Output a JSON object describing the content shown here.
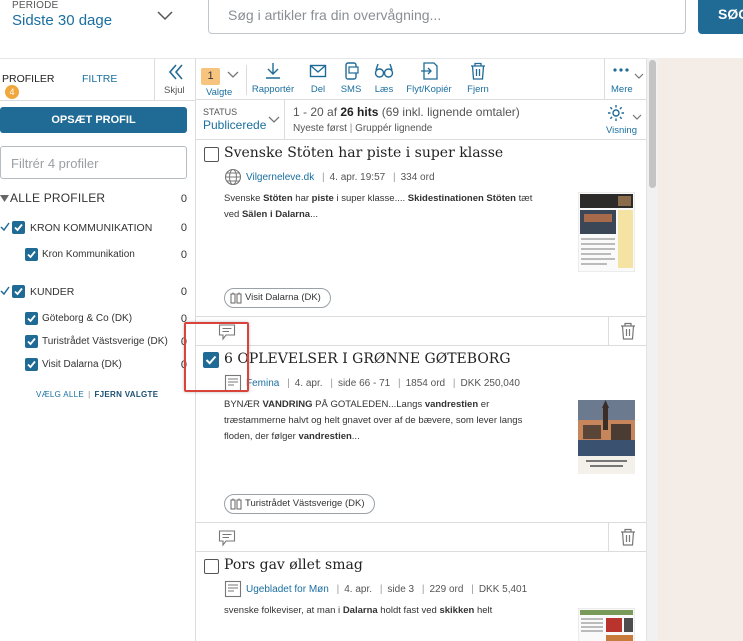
{
  "period": {
    "label": "PERIODE",
    "value": "Sidste 30 dage"
  },
  "search": {
    "placeholder": "Søg i artikler fra din overvågning...",
    "button": "SØG"
  },
  "left": {
    "tab_profiler": "PROFILER",
    "profiler_count": "4",
    "tab_filtre": "FILTRE",
    "skjul": "Skjul",
    "setup_button": "OPSÆT PROFIL",
    "filter_placeholder": "Filtrér 4 profiler",
    "all_profiles": {
      "label": "ALLE PROFILER",
      "count": "0"
    },
    "groups": [
      {
        "label": "KRON KOMMUNIKATION",
        "count": "0",
        "items": [
          {
            "label": "Kron Kommunikation",
            "count": "0"
          }
        ]
      },
      {
        "label": "KUNDER",
        "count": "0",
        "items": [
          {
            "label": "Göteborg & Co (DK)",
            "count": "0"
          },
          {
            "label": "Turistrådet Västsverige (DK)",
            "count": "0"
          },
          {
            "label": "Visit Dalarna (DK)",
            "count": "0"
          }
        ]
      }
    ],
    "select_all": "VÆLG ALLE",
    "remove_selected": "FJERN VALGTE"
  },
  "toolbar": {
    "selected_count": "1",
    "valgte": "Valgte",
    "rapporter": "Rapportér",
    "del": "Del",
    "sms": "SMS",
    "laes": "Læs",
    "flyt": "Flyt/Kopiér",
    "fjern": "Fjern",
    "mere": "Mere"
  },
  "status": {
    "label": "STATUS",
    "value": "Publicerede",
    "hits_prefix": "1 - 20 af ",
    "hits_bold": "26 hits",
    "hits_suffix": " (69 inkl. lignende omtaler)",
    "sort_newest": "Nyeste først",
    "sort_group": "Gruppér lignende",
    "visning": "Visning"
  },
  "articles": [
    {
      "title": "Svenske Stöten har piste i super klasse",
      "source": "Vilgerneleve.dk",
      "date": "4. apr. 19:57",
      "words": "334 ord",
      "snippet_parts": [
        "Svenske ",
        "Stöten",
        " har ",
        "piste",
        " i super klasse.... ",
        "Skidestinationen Stöten",
        " tæt ved ",
        "Sälen i Dalarna",
        "..."
      ],
      "tag": "Visit Dalarna (DK)",
      "checked": false
    },
    {
      "title": "6 OPLEVELSER I GRØNNE GØTEBORG",
      "source": "Femina",
      "date": "4. apr.",
      "pages": "side 66 - 71",
      "words": "1854 ord",
      "price": "DKK  250,040",
      "snippet_parts": [
        "BYNÆR ",
        "VANDRING",
        " PÅ GOTALEDEN...Langs ",
        "vandrestien",
        " er træstammerne halvt og helt gnavet over af de bævere, som lever langs floden, der følger ",
        "vandrestien",
        "..."
      ],
      "tag": "Turistrådet Västsverige (DK)",
      "checked": true
    },
    {
      "title": "Pors gav øllet smag",
      "source": "Ugebladet for Møn",
      "date": "4. apr.",
      "pages": "side 3",
      "words": "229 ord",
      "price": "DKK  5,401",
      "snippet_parts": [
        "svenske folkeviser, at man i ",
        "Dalarna",
        " holdt fast ved ",
        "skikken",
        " helt"
      ],
      "checked": false
    }
  ],
  "colors": {
    "accent": "#1f6b96",
    "link": "#1a6fa0",
    "badge": "#f0a83c",
    "highlight": "#d9443a"
  },
  "icons": [
    "chevron-down-icon",
    "double-chevron-left-icon",
    "download-icon",
    "mail-icon",
    "sms-icon",
    "glasses-icon",
    "move-copy-icon",
    "trash-icon",
    "more-dots-icon",
    "gear-icon",
    "globe-icon",
    "newspaper-icon",
    "comment-icon",
    "tag-icon",
    "checkbox-icon"
  ]
}
